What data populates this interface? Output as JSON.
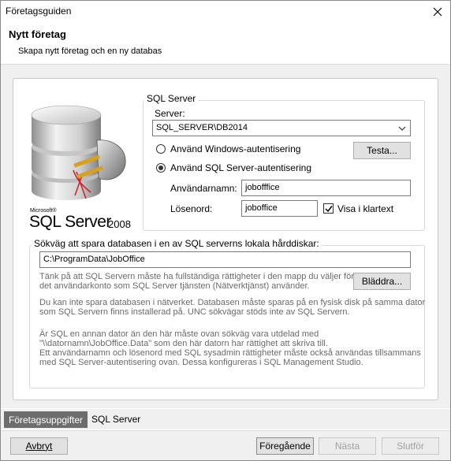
{
  "window": {
    "title": "Företagsguiden"
  },
  "header": {
    "title": "Nytt företag",
    "subtitle": "Skapa nytt företag och en ny databas"
  },
  "logo": {
    "brand_small": "Microsoft®",
    "product": "SQL Server",
    "year": "2008"
  },
  "sql_group": {
    "legend": "SQL Server",
    "server_label": "Server:",
    "server_value": "SQL_SERVER\\DB2014",
    "radio_windows": "Använd Windows-autentisering",
    "radio_sql": "Använd SQL Server-autentisering",
    "selected_auth": "sql",
    "test_button": "Testa...",
    "username_label": "Användarnamn:",
    "username_value": "jobofffice",
    "password_label": "Lösenord:",
    "password_value": "joboffice",
    "show_plaintext_label": "Visa i klartext",
    "show_plaintext_checked": true
  },
  "path_group": {
    "legend": "Sökväg att spara databasen i en av SQL serverns lokala hårddiskar:",
    "path_value": "C:\\ProgramData\\JobOffice",
    "browse_button": "Bläddra...",
    "info1": [
      "Tänk på att SQL Servern måste ha fullständiga rättigheter i den mapp du väljer för",
      "det användarkonto som SQL Server tjänsten (Nätverktjänst) använder."
    ],
    "info2": [
      "Du kan inte spara databasen i nätverket. Databasen måste sparas på en fysisk disk på samma dator",
      "som SQL Servern finns installerad på. UNC sökvägar stöds inte av SQL Servern."
    ],
    "info3": [
      "Är SQL en annan dator än den här måste ovan sökväg vara utdelad med",
      "\"\\\\datornamn\\JobOffice.Data\" som den här datorn har rättighet att skriva till.",
      "Ett användarnamn och lösenord med SQL sysadmin rättigheter måste också användas tillsammans",
      "med SQL Server-autentisering ovan. Dessa konfigureras i SQL Management Studio."
    ]
  },
  "tabs": [
    {
      "label": "Företagsuppgifter",
      "active": true
    },
    {
      "label": "SQL Server",
      "active": false
    }
  ],
  "footer": {
    "cancel": "Avbryt",
    "previous": "Föregående",
    "next": "Nästa",
    "finish": "Slutför"
  },
  "colors": {
    "tab_active_bg": "#6d6d6d",
    "sql_red": "#cc2027"
  }
}
